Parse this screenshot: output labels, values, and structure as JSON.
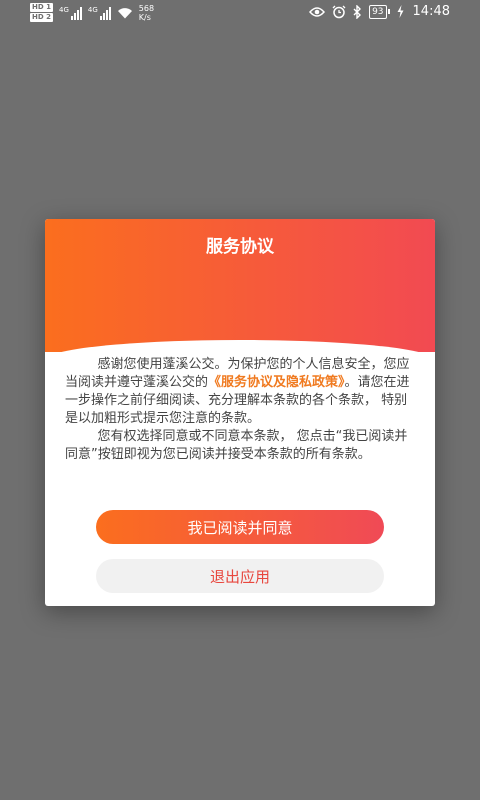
{
  "status_bar": {
    "sim1": "HD 1",
    "sim2": "HD 2",
    "network1": "4G",
    "network2": "4G",
    "net_speed_value": "568",
    "net_speed_unit": "K/s",
    "battery": "93",
    "time": "14:48"
  },
  "dialog": {
    "title": "服务协议",
    "para1_pre": "感谢您使用蓬溪公交。为保护您的个人信息安全，您应当阅读并遵守蓬溪公交的",
    "para1_link": "《服务协议及隐私政策》",
    "para1_post": "。请您在进一步操作之前仔细阅读、充分理解本条款的各个条款， 特别是以加粗形式提示您注意的条款。",
    "para2": "您有权选择同意或不同意本条款， 您点击“我已阅读并同意”按钮即视为您已阅读并接受本条款的所有条款。",
    "agree_label": "我已阅读并同意",
    "exit_label": "退出应用"
  },
  "colors": {
    "gradient_start": "#fb6e1e",
    "gradient_end": "#f24a52",
    "link": "#f07a20",
    "overlay": "#6f6f6f"
  }
}
